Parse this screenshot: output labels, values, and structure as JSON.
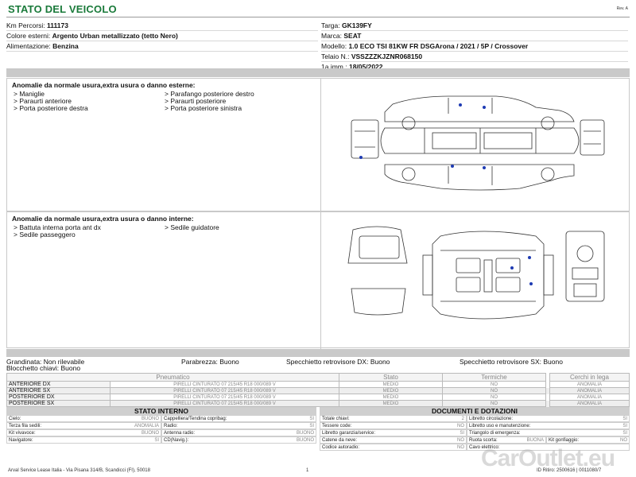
{
  "header": {
    "title": "STATO DEL VEICOLO",
    "rev": "Rev. A"
  },
  "vehicle": {
    "km_label": "Km Percorsi:",
    "km_value": "111173",
    "color_label": "Colore esterni:",
    "color_value": "Argento Urban metallizzato (tetto Nero)",
    "fuel_label": "Alimentazione:",
    "fuel_value": "Benzina",
    "plate_label": "Targa:",
    "plate_value": "GK139FY",
    "brand_label": "Marca:",
    "brand_value": "SEAT",
    "model_label": "Modello:",
    "model_value": "1.0 ECO TSI 81KW FR DSGArona / 2021 / 5P / Crossover",
    "vin_label": "Telaio N.:",
    "vin_value": "VSSZZZKJZNR068150",
    "reg_label": "1a imm.:",
    "reg_value": "18/05/2022"
  },
  "external_damage": {
    "title": "Anomalie da normale usura,extra usura o danno esterne:",
    "col1": [
      "> Maniglie",
      "> Paraurti anteriore",
      "> Porta posteriore destra"
    ],
    "col2": [
      "> Parafango posteriore destro",
      "> Paraurti posteriore",
      "> Porta posteriore sinistra"
    ]
  },
  "internal_damage": {
    "title": "Anomalie da normale usura,extra usura o danno interne:",
    "col1": [
      "> Battuta interna porta ant dx",
      "> Sedile passeggero"
    ],
    "col2": [
      "> Sedile guidatore"
    ]
  },
  "conditions": {
    "grandinata": "Grandinata: Non rilevabile",
    "parabrezza": "Parabrezza: Buono",
    "specchietto_dx": "Specchietto retrovisore DX: Buono",
    "specchietto_sx": "Specchietto retrovisore SX: Buono",
    "blocchetto": "Blocchetto chiavi: Buono"
  },
  "tyres": {
    "headers": [
      "Pneumatico",
      "Stato",
      "Termiche",
      "Cerchi in lega"
    ],
    "rows": [
      {
        "pos": "ANTERIORE DX",
        "tyre": "PIRELLI CINTURATO 07 215/45 R18 000/089 V",
        "stato": "MEDIO",
        "termiche": "NO",
        "cerchi": "ANOMALIA"
      },
      {
        "pos": "ANTERIORE SX",
        "tyre": "PIRELLI CINTURATO 07 215/45 R18 000/089 V",
        "stato": "MEDIO",
        "termiche": "NO",
        "cerchi": "ANOMALIA"
      },
      {
        "pos": "POSTERIORE DX",
        "tyre": "PIRELLI CINTURATO 07 215/45 R18 000/089 V",
        "stato": "MEDIO",
        "termiche": "NO",
        "cerchi": "ANOMALIA"
      },
      {
        "pos": "POSTERIORE SX",
        "tyre": "PIRELLI CINTURATO 07 215/45 R18 000/089 V",
        "stato": "MEDIO",
        "termiche": "NO",
        "cerchi": "ANOMALIA"
      }
    ]
  },
  "internal_state": {
    "title": "STATO INTERNO",
    "items": [
      {
        "k": "Cielo:",
        "v": "BUONO"
      },
      {
        "k": "Cappelliera/Tendina copribag:",
        "v": "SI"
      },
      {
        "k": "Terza fila sedili:",
        "v": "ANOMALIA"
      },
      {
        "k": "Radio:",
        "v": "SI"
      },
      {
        "k": "Kit vivavoce:",
        "v": "BUONO"
      },
      {
        "k": "Antenna radio:",
        "v": "BUONO"
      },
      {
        "k": "Navigatore:",
        "v": "SI"
      },
      {
        "k": "CD(Navig.):",
        "v": "BUONO"
      }
    ]
  },
  "documents": {
    "title": "DOCUMENTI E DOTAZIONI",
    "items": [
      {
        "k": "Totale chiavi:",
        "v": "2"
      },
      {
        "k": "Libretto circolazione:",
        "v": "SI"
      },
      {
        "k": "Tessere code:",
        "v": "NO"
      },
      {
        "k": "Libretto uso e manutenzione:",
        "v": "SI"
      },
      {
        "k": "Libretto garanzia/service:",
        "v": "SI"
      },
      {
        "k": "Triangolo di emergenza:",
        "v": "SI"
      },
      {
        "k": "Catene da neve:",
        "v": "NO"
      },
      {
        "k": "Ruota scorta:",
        "v": "BUONA"
      },
      {
        "k": "Codice autoradio:",
        "v": "NO"
      },
      {
        "k": "Cavo elettrico:",
        "v": ""
      }
    ],
    "kit_label": "Kit gonfiaggio:",
    "kit_value": "NO"
  },
  "footer": {
    "company": "Arval Service Lease Italia - Via Pisana 314/B, Scandicci (FI), 50018",
    "page": "1",
    "id": "ID Ritiro: 2500616 | 0011080/7"
  },
  "watermark": "CarOutlet.eu",
  "colors": {
    "title_green": "#1a7a3a",
    "damage_marker": "#1e3bb3"
  }
}
